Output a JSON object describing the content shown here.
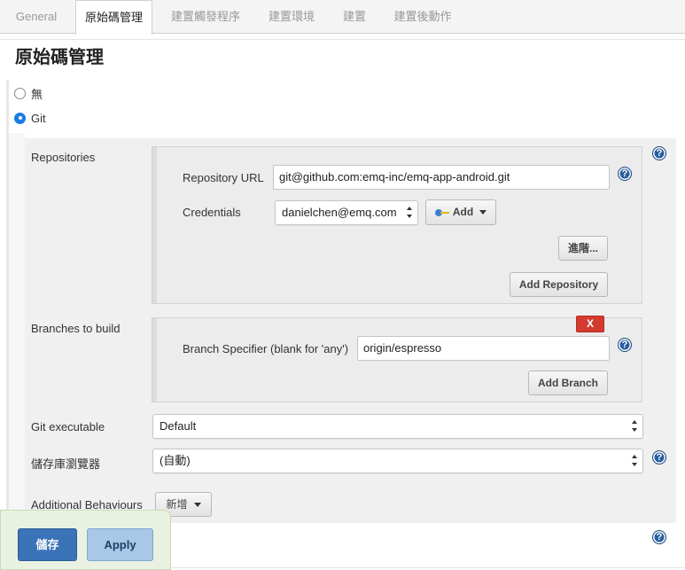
{
  "tabs": [
    {
      "label": "General"
    },
    {
      "label": "原始碼管理"
    },
    {
      "label": "建置觸發程序"
    },
    {
      "label": "建置環境"
    },
    {
      "label": "建置"
    },
    {
      "label": "建置後動作"
    }
  ],
  "section_title": "原始碼管理",
  "scm_options": [
    {
      "label": "無",
      "selected": false
    },
    {
      "label": "Git",
      "selected": true
    }
  ],
  "repositories": {
    "label": "Repositories",
    "url_label": "Repository URL",
    "url_value": "git@github.com:emq-inc/emq-app-android.git",
    "credentials_label": "Credentials",
    "credentials_value": "danielchen@emq.com",
    "add_label": "Add",
    "advanced_label": "進階...",
    "add_repository_label": "Add Repository"
  },
  "branches": {
    "label": "Branches to build",
    "delete_label": "X",
    "specifier_label": "Branch Specifier (blank for 'any')",
    "specifier_value": "origin/espresso",
    "add_branch_label": "Add Branch"
  },
  "git_executable": {
    "label": "Git executable",
    "value": "Default"
  },
  "repo_browser": {
    "label": "儲存庫瀏覽器",
    "value": "(自動)"
  },
  "additional_behaviours": {
    "label": "Additional Behaviours",
    "add_label": "新增"
  },
  "footer": {
    "save_label": "儲存",
    "apply_label": "Apply"
  },
  "help_glyph": "?",
  "colors": {
    "accent": "#3a73b8",
    "danger": "#d43b2f",
    "help": "#2a5f9e"
  }
}
